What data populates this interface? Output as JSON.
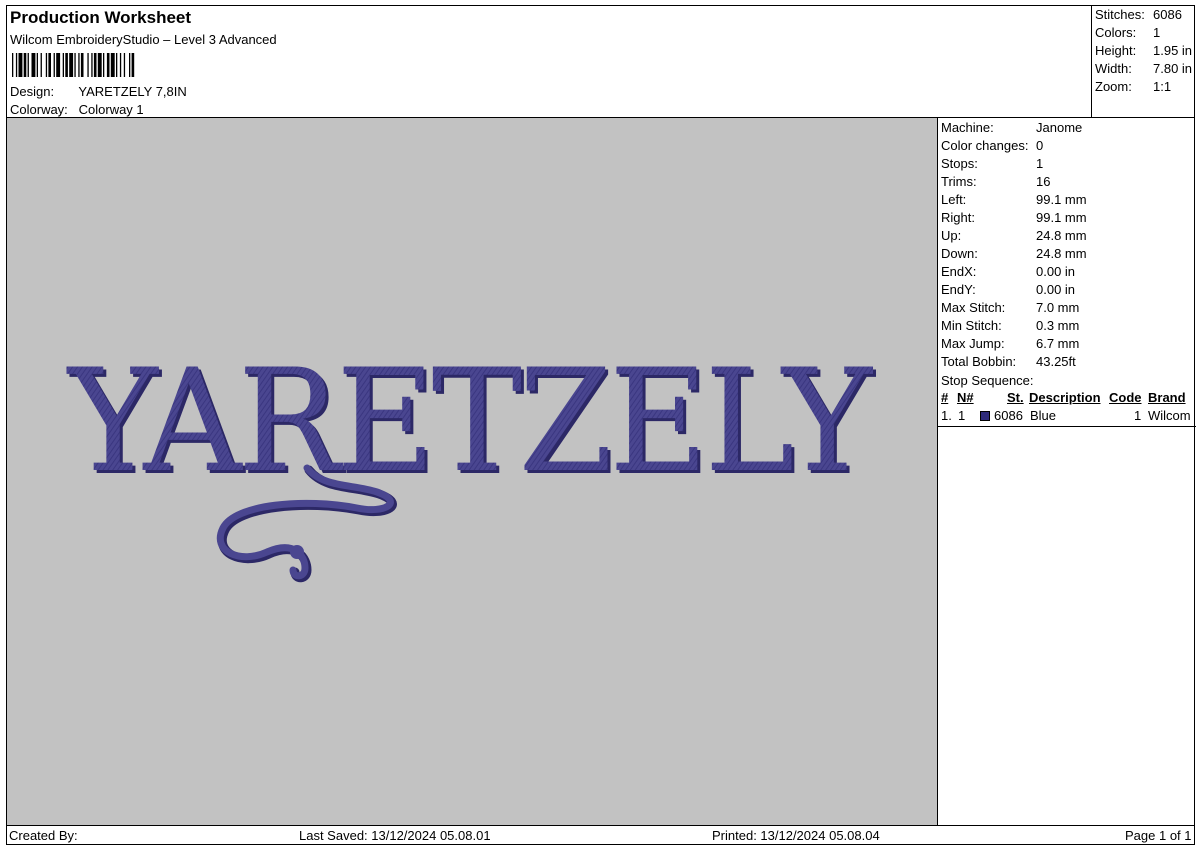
{
  "header": {
    "title": "Production Worksheet",
    "subtitle": "Wilcom EmbroideryStudio – Level 3 Advanced",
    "design_label": "Design:",
    "design_value": "YARETZELY 7,8IN",
    "colorway_label": "Colorway:",
    "colorway_value": "Colorway 1"
  },
  "summary": [
    {
      "label": "Stitches:",
      "value": "6086"
    },
    {
      "label": "Colors:",
      "value": "1"
    },
    {
      "label": "Height:",
      "value": "1.95 in"
    },
    {
      "label": "Width:",
      "value": "7.80 in"
    },
    {
      "label": "Zoom:",
      "value": "1:1"
    }
  ],
  "specs": [
    {
      "label": "Machine:",
      "value": "Janome"
    },
    {
      "label": "Color changes:",
      "value": "0"
    },
    {
      "label": "Stops:",
      "value": "1"
    },
    {
      "label": "Trims:",
      "value": "16"
    },
    {
      "label": "Left:",
      "value": "99.1 mm"
    },
    {
      "label": "Right:",
      "value": "99.1 mm"
    },
    {
      "label": "Up:",
      "value": "24.8 mm"
    },
    {
      "label": "Down:",
      "value": "24.8 mm"
    },
    {
      "label": "EndX:",
      "value": "0.00 in"
    },
    {
      "label": "EndY:",
      "value": "0.00 in"
    },
    {
      "label": "Max Stitch:",
      "value": "7.0 mm"
    },
    {
      "label": "Min Stitch:",
      "value": "0.3 mm"
    },
    {
      "label": "Max Jump:",
      "value": "6.7 mm"
    },
    {
      "label": "Total Bobbin:",
      "value": "43.25ft"
    }
  ],
  "stop_sequence": {
    "title": "Stop Sequence:",
    "headers": {
      "num": "#",
      "n": "N#",
      "st": "St.",
      "description": "Description",
      "code": "Code",
      "brand": "Brand"
    },
    "rows": [
      {
        "num": "1.",
        "n": "1",
        "st": "6086",
        "description": "Blue",
        "code": "1",
        "brand": "Wilcom",
        "swatch_color": "#2e2a7a"
      }
    ]
  },
  "design": {
    "text": "YARETZELY",
    "thread_color": "#4a4690",
    "shadow_color": "#2c2866",
    "background": "#c2c2c2"
  },
  "footer": {
    "created_by": "Created By:",
    "last_saved": "Last Saved: 13/12/2024 05.08.01",
    "printed": "Printed: 13/12/2024 05.08.04",
    "page": "Page 1 of 1"
  }
}
